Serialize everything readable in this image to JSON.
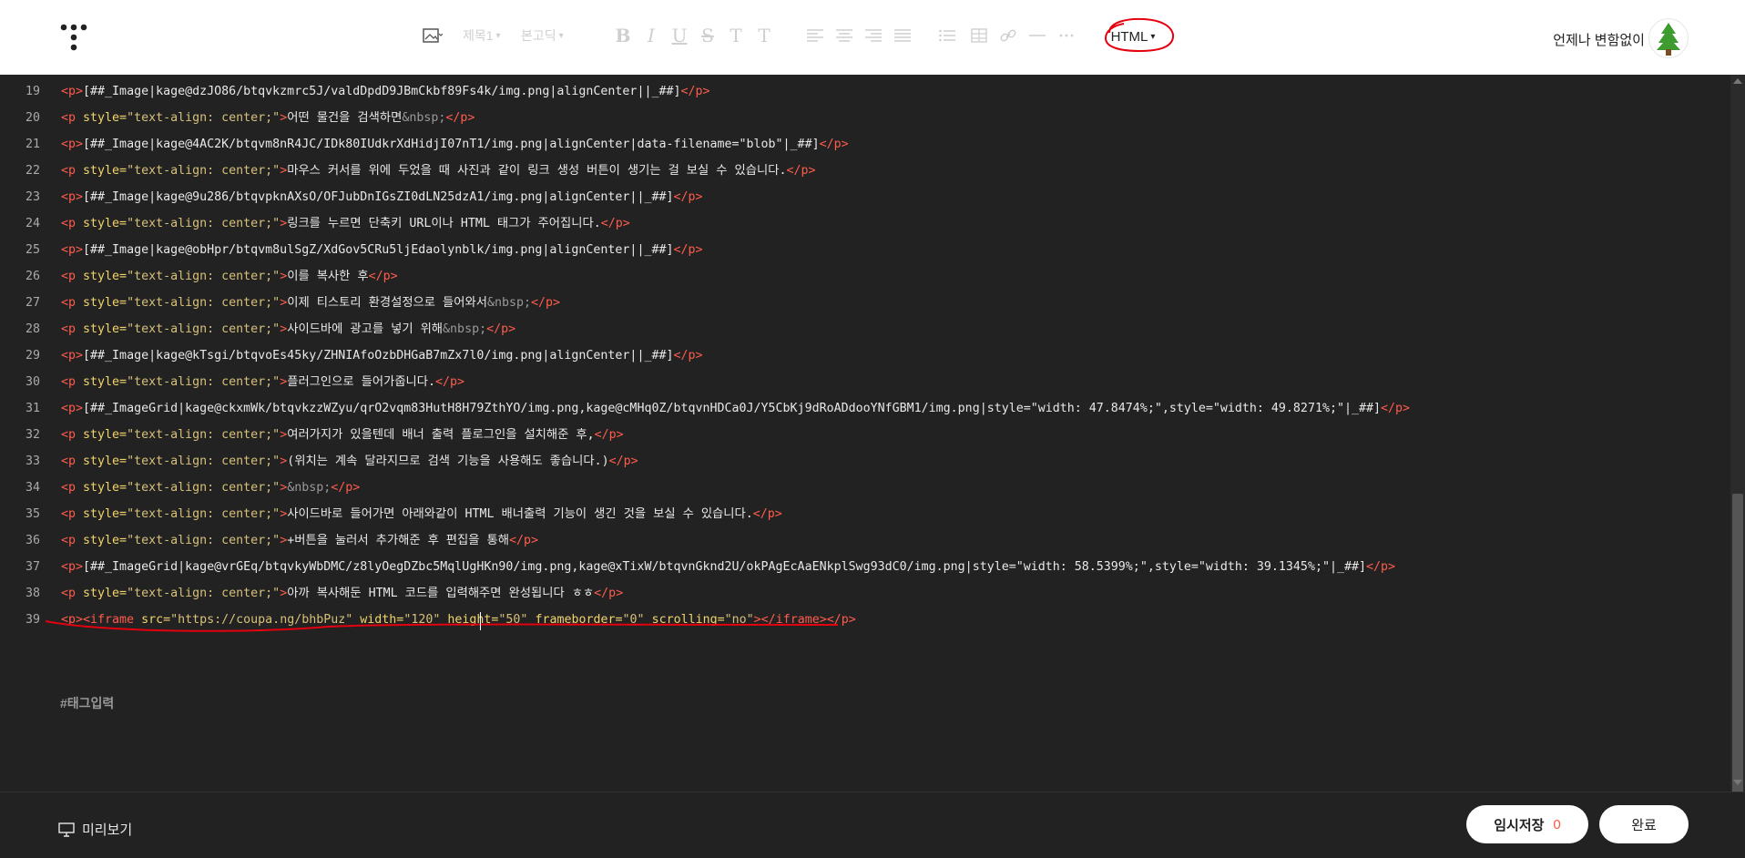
{
  "toolbar": {
    "image_icon": "image-icon",
    "heading_label": "제목1",
    "font_label": "본고딕",
    "bold": "B",
    "italic": "I",
    "underline": "U",
    "strike": "S",
    "text_color": "T",
    "bg_color": "T",
    "mode_label": "HTML"
  },
  "user": {
    "blog_name": "언제나 변함없이"
  },
  "editor": {
    "lines": [
      {
        "n": "19",
        "html": "<span class='tag'>&lt;p&gt;</span>[##_Image|kage@dzJO86/btqvkzmrc5J/valdDpdD9JBmCkbf89Fs4k/img.png|alignCenter||_##]<span class='tag'>&lt;/p&gt;</span>"
      },
      {
        "n": "20",
        "html": "<span class='tag'>&lt;p</span> <span class='attr'>style=</span><span class='val'>\"text-align: center;\"</span><span class='tag'>&gt;</span>어떤 물건을 검색하면<span style='color:#999'>&amp;nbsp;</span><span class='tag'>&lt;/p&gt;</span>"
      },
      {
        "n": "21",
        "html": "<span class='tag'>&lt;p&gt;</span>[##_Image|kage@4AC2K/btqvm8nR4JC/IDk80IUdkrXdHidjI07nT1/img.png|alignCenter|data-filename=\"blob\"|_##]<span class='tag'>&lt;/p&gt;</span>"
      },
      {
        "n": "22",
        "html": "<span class='tag'>&lt;p</span> <span class='attr'>style=</span><span class='val'>\"text-align: center;\"</span><span class='tag'>&gt;</span>마우스 커서를 위에 두었을 때 사진과 같이 링크 생성 버튼이 생기는 걸 보실 수 있습니다.<span class='tag'>&lt;/p&gt;</span>"
      },
      {
        "n": "23",
        "html": "<span class='tag'>&lt;p&gt;</span>[##_Image|kage@9u286/btqvpknAXsO/OFJubDnIGsZI0dLN25dzA1/img.png|alignCenter||_##]<span class='tag'>&lt;/p&gt;</span>"
      },
      {
        "n": "24",
        "html": "<span class='tag'>&lt;p</span> <span class='attr'>style=</span><span class='val'>\"text-align: center;\"</span><span class='tag'>&gt;</span>링크를 누르면 단축키 URL이나 HTML 태그가 주어집니다.<span class='tag'>&lt;/p&gt;</span>"
      },
      {
        "n": "25",
        "html": "<span class='tag'>&lt;p&gt;</span>[##_Image|kage@obHpr/btqvm8ulSgZ/XdGov5CRu5ljEdaolynblk/img.png|alignCenter||_##]<span class='tag'>&lt;/p&gt;</span>"
      },
      {
        "n": "26",
        "html": "<span class='tag'>&lt;p</span> <span class='attr'>style=</span><span class='val'>\"text-align: center;\"</span><span class='tag'>&gt;</span>이를 복사한 후<span class='tag'>&lt;/p&gt;</span>"
      },
      {
        "n": "27",
        "html": "<span class='tag'>&lt;p</span> <span class='attr'>style=</span><span class='val'>\"text-align: center;\"</span><span class='tag'>&gt;</span>이제 티스토리 환경설정으로 들어와서<span style='color:#999'>&amp;nbsp;</span><span class='tag'>&lt;/p&gt;</span>"
      },
      {
        "n": "28",
        "html": "<span class='tag'>&lt;p</span> <span class='attr'>style=</span><span class='val'>\"text-align: center;\"</span><span class='tag'>&gt;</span>사이드바에 광고를 넣기 위해<span style='color:#999'>&amp;nbsp;</span><span class='tag'>&lt;/p&gt;</span>"
      },
      {
        "n": "29",
        "html": "<span class='tag'>&lt;p&gt;</span>[##_Image|kage@kTsgi/btqvoEs45ky/ZHNIAfoOzbDHGaB7mZx7l0/img.png|alignCenter||_##]<span class='tag'>&lt;/p&gt;</span>"
      },
      {
        "n": "30",
        "html": "<span class='tag'>&lt;p</span> <span class='attr'>style=</span><span class='val'>\"text-align: center;\"</span><span class='tag'>&gt;</span>플러그인으로 들어가줍니다.<span class='tag'>&lt;/p&gt;</span>"
      },
      {
        "n": "31",
        "html": "<span class='tag'>&lt;p&gt;</span>[##_ImageGrid|kage@ckxmWk/btqvkzzWZyu/qrO2vqm83HutH8H79ZthYO/img.png,kage@cMHq0Z/btqvnHDCa0J/Y5CbKj9dRoADdooYNfGBM1/img.png|style=\"width: 47.8474%;\",style=\"width: 49.8271%;\"|_##]<span class='tag'>&lt;/p&gt;</span>"
      },
      {
        "n": "32",
        "html": "<span class='tag'>&lt;p</span> <span class='attr'>style=</span><span class='val'>\"text-align: center;\"</span><span class='tag'>&gt;</span>여러가지가 있을텐데 배너 출력 플로그인을 설치해준 후,<span class='tag'>&lt;/p&gt;</span>"
      },
      {
        "n": "33",
        "html": "<span class='tag'>&lt;p</span> <span class='attr'>style=</span><span class='val'>\"text-align: center;\"</span><span class='tag'>&gt;</span>(위치는 계속 달라지므로 검색 기능을 사용해도 좋습니다.)<span class='tag'>&lt;/p&gt;</span>"
      },
      {
        "n": "34",
        "html": "<span class='tag'>&lt;p</span> <span class='attr'>style=</span><span class='val'>\"text-align: center;\"</span><span class='tag'>&gt;</span><span style='color:#999'>&amp;nbsp;</span><span class='tag'>&lt;/p&gt;</span>"
      },
      {
        "n": "35",
        "html": "<span class='tag'>&lt;p</span> <span class='attr'>style=</span><span class='val'>\"text-align: center;\"</span><span class='tag'>&gt;</span>사이드바로 들어가면 아래와같이 HTML 배너출력 기능이 생긴 것을 보실 수 있습니다.<span class='tag'>&lt;/p&gt;</span>"
      },
      {
        "n": "36",
        "html": "<span class='tag'>&lt;p</span> <span class='attr'>style=</span><span class='val'>\"text-align: center;\"</span><span class='tag'>&gt;</span>+버튼을 눌러서 추가해준 후 편집을 통해<span class='tag'>&lt;/p&gt;</span>"
      },
      {
        "n": "37",
        "html": "<span class='tag'>&lt;p&gt;</span>[##_ImageGrid|kage@vrGEq/btqvkyWbDMC/z8lyOegDZbc5MqlUgHKn90/img.png,kage@xTixW/btqvnGknd2U/okPAgEcAaENkplSwg93dC0/img.png|style=\"width: 58.5399%;\",style=\"width: 39.1345%;\"|_##]<span class='tag'>&lt;/p&gt;</span>"
      },
      {
        "n": "38",
        "html": "<span class='tag'>&lt;p</span> <span class='attr'>style=</span><span class='val'>\"text-align: center;\"</span><span class='tag'>&gt;</span>아까 복사해둔 HTML 코드를 입력해주면 완성됩니다 ㅎㅎ<span class='tag'>&lt;/p&gt;</span>"
      },
      {
        "n": "39",
        "html": "<span class='tag'>&lt;p&gt;&lt;iframe</span> <span class='attr'>src=</span><span class='val'>\"https://coupa.ng/bhbPuz\"</span> <span class='attr'>width=</span><span class='val'>\"120\"</span> <span class='attr'>height=</span><span class='val'>\"50\"</span> <span class='attr'>frameborder=</span><span class='val'>\"0\"</span> <span class='attr'>scrolling=</span><span class='val'>\"no\"</span><span class='tag'>&gt;&lt;/iframe&gt;&lt;/p&gt;</span>"
      }
    ]
  },
  "tags": {
    "placeholder": "#태그입력"
  },
  "footer": {
    "preview_label": "미리보기",
    "save_label": "임시저장",
    "save_count": "0",
    "done_label": "완료"
  },
  "colors": {
    "accent": "#ff5544",
    "editor_bg": "#222222",
    "tag": "#ff5c4d"
  }
}
